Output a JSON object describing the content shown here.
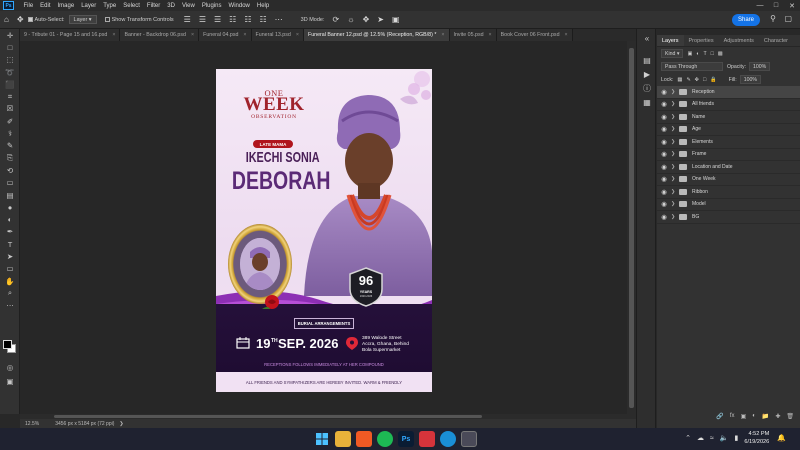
{
  "menubar": {
    "logo": "Ps",
    "items": [
      "File",
      "Edit",
      "Image",
      "Layer",
      "Type",
      "Select",
      "Filter",
      "3D",
      "View",
      "Plugins",
      "Window",
      "Help"
    ]
  },
  "options": {
    "auto_select_label": "Auto-Select:",
    "auto_select_value": "Layer",
    "transform_controls_label": "Show Transform Controls",
    "mode_3d_label": "3D Mode:",
    "share_label": "Share"
  },
  "tabs": [
    {
      "label": "9 - Tribute 01 - Page 15 and 16.psd",
      "active": false
    },
    {
      "label": "Banner - Backdrop 06.psd",
      "active": false
    },
    {
      "label": "Funeral 04.psd",
      "active": false
    },
    {
      "label": "Funeral 13.psd",
      "active": false
    },
    {
      "label": "Funeral Banner 12.psd @ 12.5% (Reception, RGB/8) *",
      "active": true
    },
    {
      "label": "Invite 05.psd",
      "active": false
    },
    {
      "label": "Book Cover 06 Front.psd",
      "active": false
    }
  ],
  "poster": {
    "one": "ONE",
    "week": "WEEK",
    "observation": "OBSERVATION",
    "late_label": "LATE MAMA",
    "name_first": "IKECHI SONIA",
    "name_last": "DEBORAH",
    "age": "96",
    "years": "YEARS",
    "year_range": "1930-2026",
    "burial": "BURIAL ARRANGEMENTS",
    "date_day": "19",
    "date_suffix": "TH",
    "date_rest": "SEP. 2026",
    "address": [
      "389 Walode Street",
      "Accra, Ghana, Behind",
      "Bola Supermarket"
    ],
    "reception_note": "RECEPTIONS FOLLOWS IMMEDIATELY AT HER COMPOUND",
    "footer_note": "ALL FRIENDS AND SYMPATHIZERS ARE HEREBY INVITED. WARM & FRIENDLY"
  },
  "status": {
    "zoom": "12.5%",
    "doc_size": "3456 px x 5184 px (72 ppi)"
  },
  "panel": {
    "tabs": [
      "Layers",
      "Properties",
      "Adjustments",
      "Character"
    ],
    "kind_label": "Kind",
    "blend_mode": "Pass Through",
    "opacity_label": "Opacity:",
    "opacity_value": "100%",
    "lock_label": "Lock:",
    "fill_label": "Fill:",
    "fill_value": "100%",
    "layers": [
      {
        "name": "Reception",
        "selected": true
      },
      {
        "name": "All friends",
        "selected": false
      },
      {
        "name": "Name",
        "selected": false
      },
      {
        "name": "Age",
        "selected": false
      },
      {
        "name": "Elements",
        "selected": false
      },
      {
        "name": "Frame",
        "selected": false
      },
      {
        "name": "Location and Date",
        "selected": false
      },
      {
        "name": "One Week",
        "selected": false
      },
      {
        "name": "Ribbon",
        "selected": false
      },
      {
        "name": "Model",
        "selected": false
      },
      {
        "name": "BG",
        "selected": false
      }
    ]
  },
  "taskbar": {
    "time": "4:52 PM",
    "date": "6/19/2026"
  },
  "colors": {
    "accent": "#1473e6",
    "poster_title": "#a0232c",
    "poster_name": "#5b2a76",
    "poster_dark": "#25103a"
  }
}
